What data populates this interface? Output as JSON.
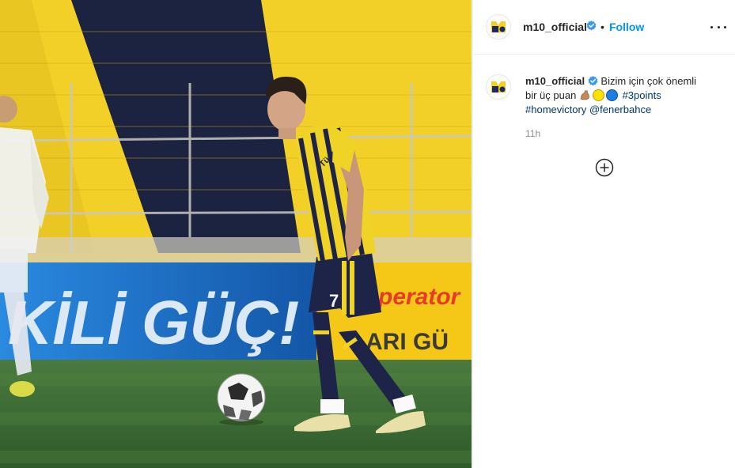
{
  "post": {
    "username": "m10_official",
    "follow_label": "Follow",
    "separator": "•",
    "caption": {
      "username": "m10_official",
      "text_line1": "Bizim için çok önemli",
      "text_line2": "bir üç puan",
      "emojis": [
        "flexed-biceps-icon",
        "yellow-circle-icon",
        "blue-circle-icon"
      ],
      "hashtags": [
        "#3points",
        "#homevictory"
      ],
      "mention": "@fenerbahce"
    },
    "timestamp": "11h"
  },
  "photo": {
    "banner_text": "KİLİ GÜÇ!",
    "sponsor_text": "perator",
    "sponsor_text2": "ARI GÜ",
    "jersey_number": "7",
    "jersey_sponsor": "Türk"
  },
  "colors": {
    "accent": "#0095f6",
    "link": "#00376b",
    "verified": "#3897f0",
    "stand_yellow": "#f3d027",
    "stand_navy": "#1c2340",
    "pitch": "#3d6a35",
    "banner_blue": "#1d6fc4"
  }
}
